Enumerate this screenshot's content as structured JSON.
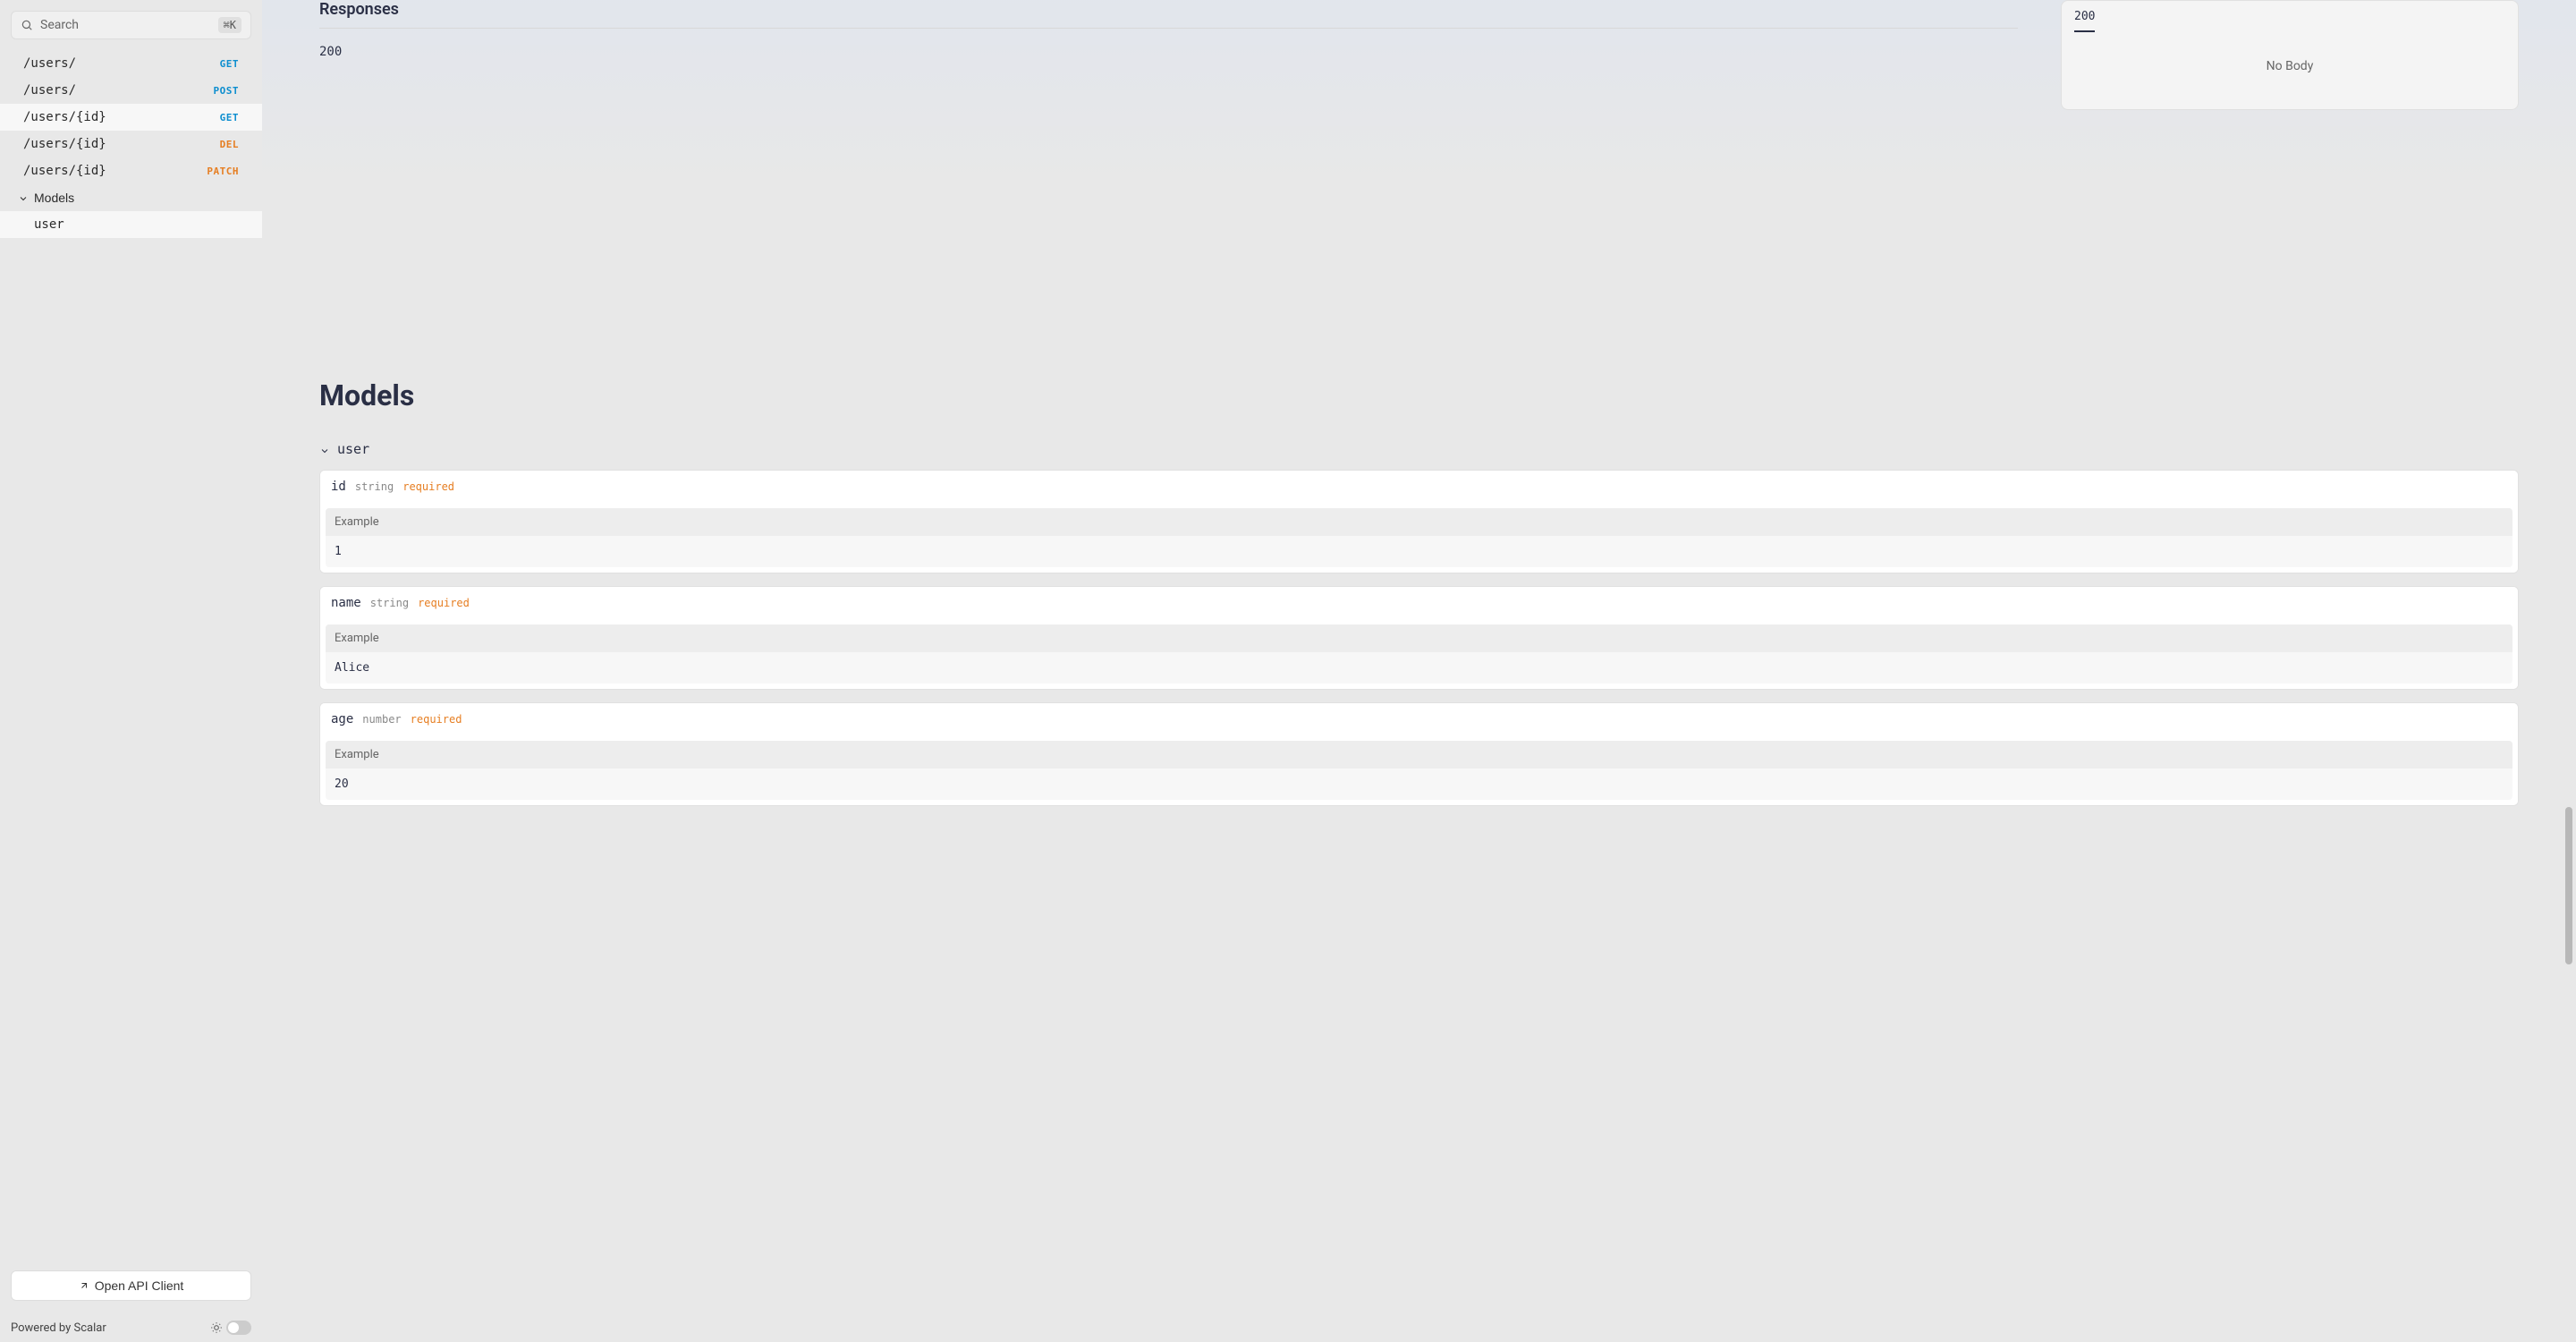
{
  "search": {
    "placeholder": "Search",
    "shortcut": "⌘K"
  },
  "sidebar": {
    "items": [
      {
        "path": "/users/",
        "method": "GET",
        "class": "m-get"
      },
      {
        "path": "/users/",
        "method": "POST",
        "class": "m-post"
      },
      {
        "path": "/users/{id}",
        "method": "GET",
        "class": "m-get"
      },
      {
        "path": "/users/{id}",
        "method": "DEL",
        "class": "m-del"
      },
      {
        "path": "/users/{id}",
        "method": "PATCH",
        "class": "m-patch"
      }
    ],
    "models_label": "Models",
    "model_items": [
      "user"
    ],
    "api_client_label": "Open API Client",
    "powered_label": "Powered by Scalar"
  },
  "responses": {
    "title": "Responses",
    "code": "200",
    "panel_tab": "200",
    "panel_body": "No Body"
  },
  "models": {
    "title": "Models",
    "user_name": "user",
    "example_label": "Example",
    "required_label": "required",
    "props": [
      {
        "name": "id",
        "type": "string",
        "example": "1"
      },
      {
        "name": "name",
        "type": "string",
        "example": "Alice"
      },
      {
        "name": "age",
        "type": "number",
        "example": "20"
      }
    ]
  }
}
